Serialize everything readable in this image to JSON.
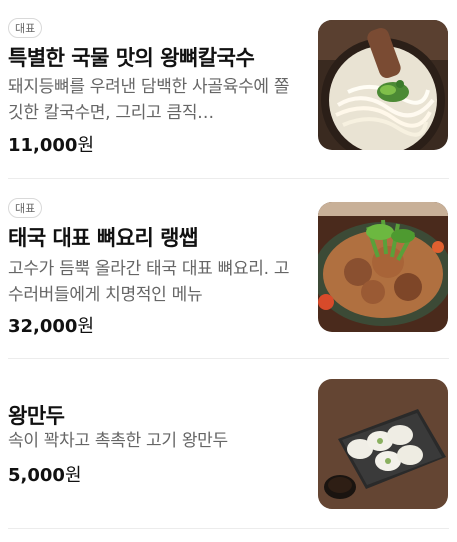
{
  "menu": {
    "items": [
      {
        "badge": "대표",
        "name": "특별한 국물 맛의 왕뼈칼국수",
        "description": "돼지등뼈를 우려낸 담백한 사골육수에 쫄깃한 칼국수면, 그리고 큼직…",
        "price": "11,000",
        "currency": "원",
        "image_icon": "noodle-soup-photo"
      },
      {
        "badge": "대표",
        "name": "태국 대표 뼈요리 랭쌥",
        "description": "고수가 듬뿍 올라간 태국 대표 뼈요리. 고수러버들에게 치명적인 메뉴",
        "price": "32,000",
        "currency": "원",
        "image_icon": "pork-bone-platter-photo"
      },
      {
        "name": "왕만두",
        "description": "속이 꽉차고 촉촉한 고기 왕만두",
        "price": "5,000",
        "currency": "원",
        "image_icon": "dumplings-photo"
      }
    ]
  },
  "colors": {
    "title_text": "#111111",
    "description_text": "#666666",
    "badge_border": "#d9d9d9",
    "divider": "#ececec"
  }
}
